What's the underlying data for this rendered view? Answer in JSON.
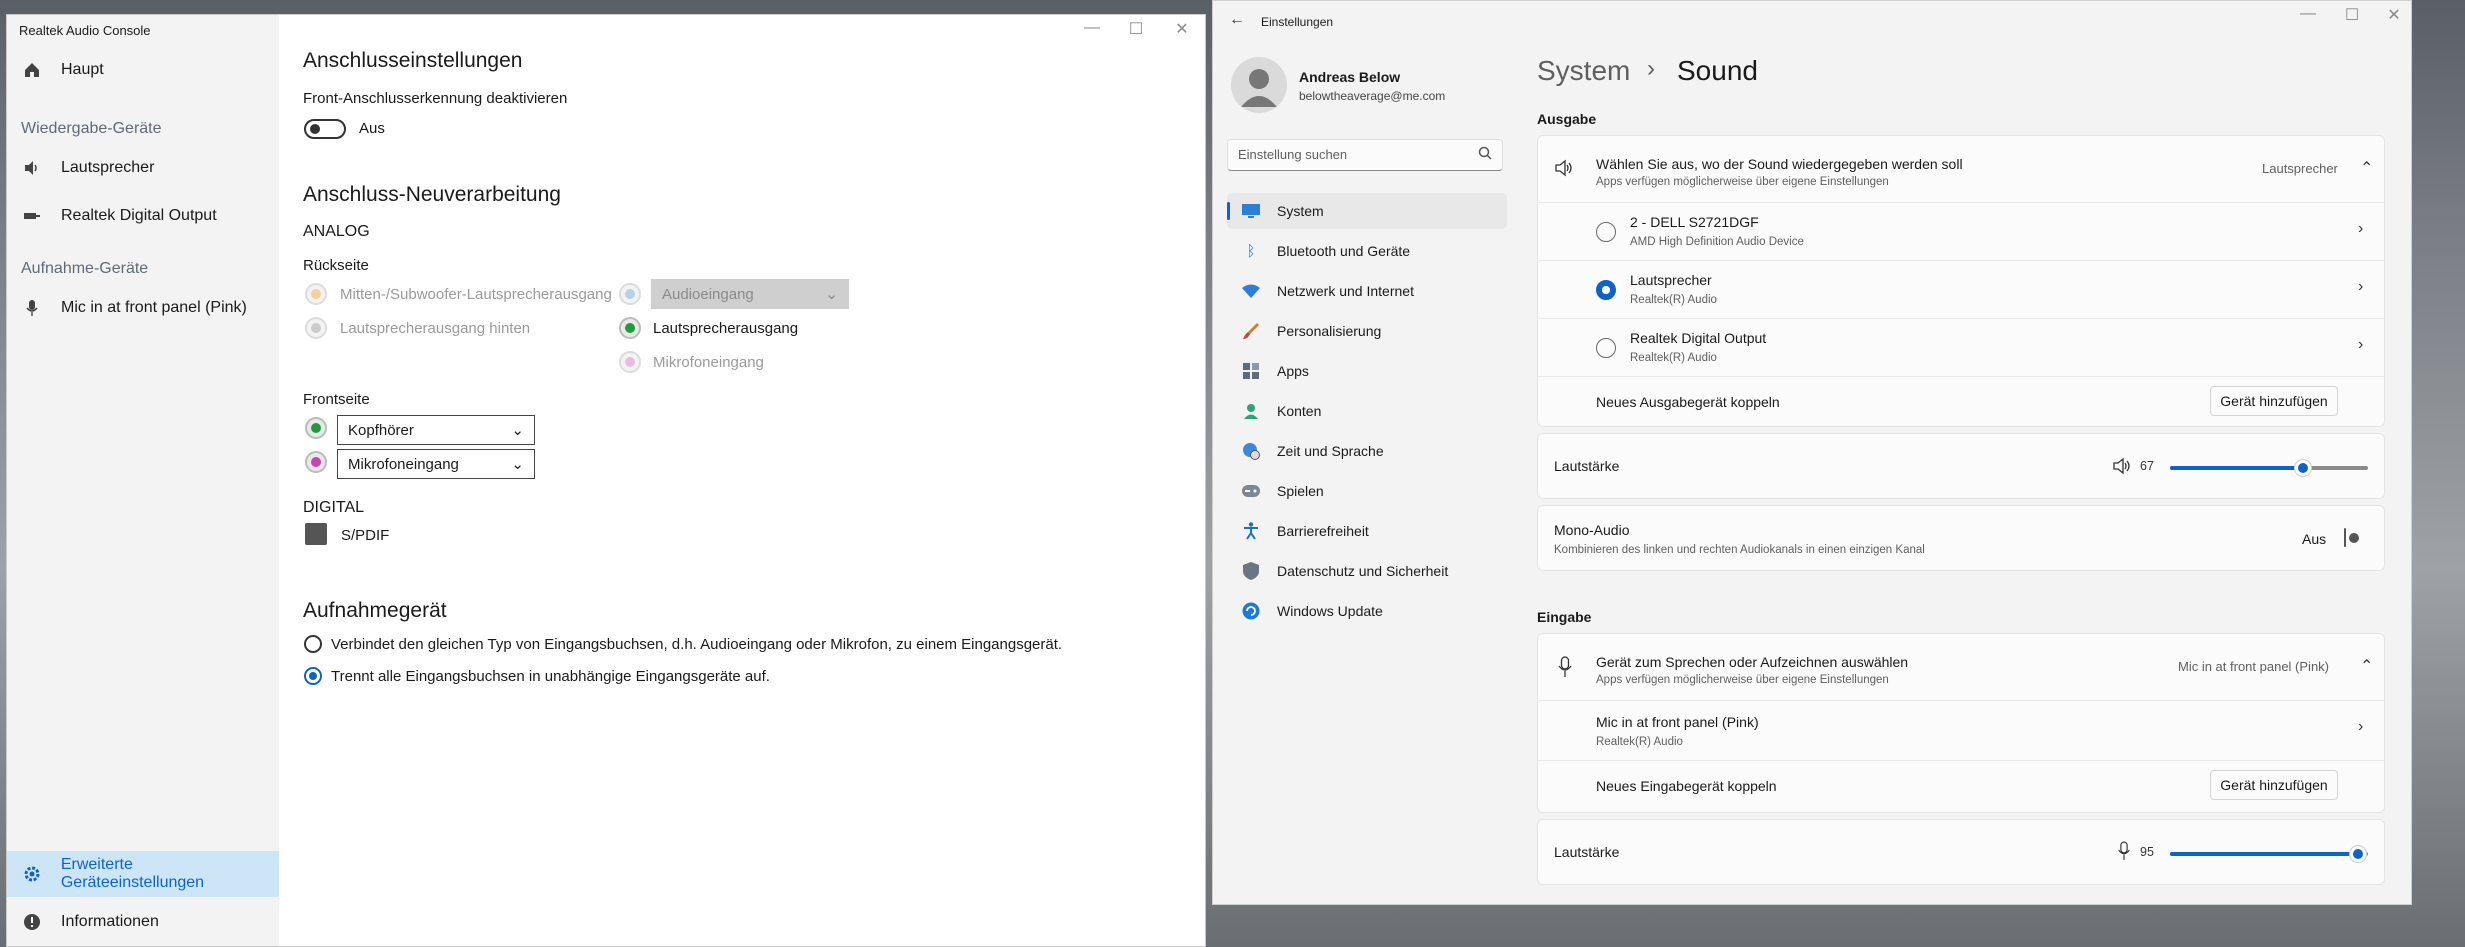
{
  "realtek": {
    "title": "Realtek Audio Console",
    "nav_main": "Haupt",
    "section_playback": "Wiedergabe-Geräte",
    "nav_speakers": "Lautsprecher",
    "nav_digital": "Realtek Digital Output",
    "section_recording": "Aufnahme-Geräte",
    "nav_mic": "Mic in at front panel (Pink)",
    "nav_advanced": "Erweiterte Geräteeinstellungen",
    "nav_info": "Informationen",
    "h_connector": "Anschlusseinstellungen",
    "front_detect_label": "Front-Anschlusserkennung deaktivieren",
    "front_detect_state": "Aus",
    "h_reprocess": "Anschluss-Neuverarbeitung",
    "analog": "ANALOG",
    "rear": "Rückseite",
    "rear_center_sub": "Mitten-/Subwoofer-Lautsprecherausgang",
    "rear_back": "Lautsprecherausgang hinten",
    "rear_line_in_select": "Audioeingang",
    "rear_speaker_out": "Lautsprecherausgang",
    "rear_mic_in": "Mikrofoneingang",
    "front": "Frontseite",
    "front_jack1": "Kopfhörer",
    "front_jack2": "Mikrofoneingang",
    "digital": "DIGITAL",
    "spdif": "S/PDIF",
    "h_recording_device": "Aufnahmegerät",
    "rec_option1": "Verbindet den gleichen Typ von Eingangsbuchsen, d.h. Audioeingang oder Mikrofon, zu einem Eingangsgerät.",
    "rec_option2": "Trennt alle Eingangsbuchsen in unabhängige Eingangsgeräte auf.",
    "colors": {
      "accent": "#0f63c7",
      "active_bg": "#cde6f7"
    }
  },
  "settings": {
    "title": "Einstellungen",
    "user_name": "Andreas Below",
    "user_email": "belowtheaverage@me.com",
    "search_placeholder": "Einstellung suchen",
    "nav": [
      {
        "label": "System",
        "icon": "monitor-icon"
      },
      {
        "label": "Bluetooth und Geräte",
        "icon": "bluetooth-icon"
      },
      {
        "label": "Netzwerk und Internet",
        "icon": "wifi-icon"
      },
      {
        "label": "Personalisierung",
        "icon": "brush-icon"
      },
      {
        "label": "Apps",
        "icon": "apps-icon"
      },
      {
        "label": "Konten",
        "icon": "person-icon"
      },
      {
        "label": "Zeit und Sprache",
        "icon": "globe-clock-icon"
      },
      {
        "label": "Spielen",
        "icon": "gamepad-icon"
      },
      {
        "label": "Barrierefreiheit",
        "icon": "accessibility-icon"
      },
      {
        "label": "Datenschutz und Sicherheit",
        "icon": "shield-icon"
      },
      {
        "label": "Windows Update",
        "icon": "update-icon"
      }
    ],
    "breadcrumb_parent": "System",
    "breadcrumb_sep": "›",
    "breadcrumb_current": "Sound",
    "output_h": "Ausgabe",
    "output_choose_title": "Wählen Sie aus, wo der Sound wiedergegeben werden soll",
    "output_choose_sub": "Apps verfügen möglicherweise über eigene Einstellungen",
    "output_choose_value": "Lautsprecher",
    "output_devices": [
      {
        "name": "2 - DELL S2721DGF",
        "sub": "AMD High Definition Audio Device",
        "selected": false
      },
      {
        "name": "Lautsprecher",
        "sub": "Realtek(R) Audio",
        "selected": true
      },
      {
        "name": "Realtek Digital Output",
        "sub": "Realtek(R) Audio",
        "selected": false
      }
    ],
    "pair_output": "Neues Ausgabegerät koppeln",
    "add_device": "Gerät hinzufügen",
    "volume_label": "Lautstärke",
    "output_volume": "67",
    "output_volume_fraction": 0.67,
    "mono_title": "Mono-Audio",
    "mono_sub": "Kombinieren des linken und rechten Audiokanals in einen einzigen Kanal",
    "mono_state": "Aus",
    "input_h": "Eingabe",
    "input_choose_title": "Gerät zum Sprechen oder Aufzeichnen auswählen",
    "input_choose_sub": "Apps verfügen möglicherweise über eigene Einstellungen",
    "input_choose_value": "Mic in at front panel (Pink)",
    "input_device_name": "Mic in at front panel (Pink)",
    "input_device_sub": "Realtek(R) Audio",
    "pair_input": "Neues Eingabegerät koppeln",
    "add_device2": "Gerät hinzufügen",
    "input_volume": "95",
    "input_volume_fraction": 0.95,
    "colors": {
      "accent": "#0f63c7"
    }
  }
}
